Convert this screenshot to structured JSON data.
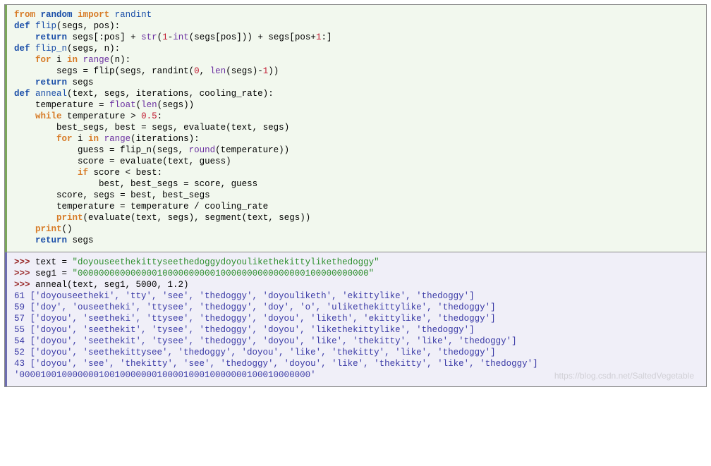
{
  "code": {
    "lines": [
      [
        [
          "kw-orange",
          "from"
        ],
        [
          "text",
          " "
        ],
        [
          "kw-blue",
          "random"
        ],
        [
          "text",
          " "
        ],
        [
          "kw-orange",
          "import"
        ],
        [
          "text",
          " "
        ],
        [
          "def",
          "randint"
        ]
      ],
      [
        [
          "text",
          ""
        ]
      ],
      [
        [
          "kw-blue",
          "def"
        ],
        [
          "text",
          " "
        ],
        [
          "def",
          "flip"
        ],
        [
          "op",
          "("
        ],
        [
          "text",
          "segs"
        ],
        [
          "op",
          ", "
        ],
        [
          "text",
          "pos"
        ],
        [
          "op",
          ")"
        ],
        [
          "op",
          ":"
        ]
      ],
      [
        [
          "text",
          "    "
        ],
        [
          "kw-blue",
          "return"
        ],
        [
          "text",
          " segs"
        ],
        [
          "op",
          "["
        ],
        [
          "op",
          ":"
        ],
        [
          "text",
          "pos"
        ],
        [
          "op",
          "]"
        ],
        [
          "text",
          " "
        ],
        [
          "op",
          "+"
        ],
        [
          "text",
          " "
        ],
        [
          "builtin",
          "str"
        ],
        [
          "op",
          "("
        ],
        [
          "num",
          "1"
        ],
        [
          "op",
          "-"
        ],
        [
          "builtin",
          "int"
        ],
        [
          "op",
          "("
        ],
        [
          "text",
          "segs"
        ],
        [
          "op",
          "["
        ],
        [
          "text",
          "pos"
        ],
        [
          "op",
          "]"
        ],
        [
          "op",
          ")"
        ],
        [
          "op",
          ")"
        ],
        [
          "text",
          " "
        ],
        [
          "op",
          "+"
        ],
        [
          "text",
          " segs"
        ],
        [
          "op",
          "["
        ],
        [
          "text",
          "pos"
        ],
        [
          "op",
          "+"
        ],
        [
          "num",
          "1"
        ],
        [
          "op",
          ":"
        ],
        [
          "op",
          "]"
        ]
      ],
      [
        [
          "text",
          ""
        ]
      ],
      [
        [
          "kw-blue",
          "def"
        ],
        [
          "text",
          " "
        ],
        [
          "def",
          "flip_n"
        ],
        [
          "op",
          "("
        ],
        [
          "text",
          "segs"
        ],
        [
          "op",
          ", "
        ],
        [
          "text",
          "n"
        ],
        [
          "op",
          ")"
        ],
        [
          "op",
          ":"
        ]
      ],
      [
        [
          "text",
          "    "
        ],
        [
          "kw-orange",
          "for"
        ],
        [
          "text",
          " i "
        ],
        [
          "kw-orange",
          "in"
        ],
        [
          "text",
          " "
        ],
        [
          "builtin",
          "range"
        ],
        [
          "op",
          "("
        ],
        [
          "text",
          "n"
        ],
        [
          "op",
          ")"
        ],
        [
          "op",
          ":"
        ]
      ],
      [
        [
          "text",
          "        segs "
        ],
        [
          "op",
          "="
        ],
        [
          "text",
          " flip"
        ],
        [
          "op",
          "("
        ],
        [
          "text",
          "segs"
        ],
        [
          "op",
          ", "
        ],
        [
          "text",
          "randint"
        ],
        [
          "op",
          "("
        ],
        [
          "num",
          "0"
        ],
        [
          "op",
          ", "
        ],
        [
          "builtin",
          "len"
        ],
        [
          "op",
          "("
        ],
        [
          "text",
          "segs"
        ],
        [
          "op",
          ")"
        ],
        [
          "op",
          "-"
        ],
        [
          "num",
          "1"
        ],
        [
          "op",
          ")"
        ],
        [
          "op",
          ")"
        ]
      ],
      [
        [
          "text",
          "    "
        ],
        [
          "kw-blue",
          "return"
        ],
        [
          "text",
          " segs"
        ]
      ],
      [
        [
          "text",
          ""
        ]
      ],
      [
        [
          "kw-blue",
          "def"
        ],
        [
          "text",
          " "
        ],
        [
          "def",
          "anneal"
        ],
        [
          "op",
          "("
        ],
        [
          "text",
          "text"
        ],
        [
          "op",
          ", "
        ],
        [
          "text",
          "segs"
        ],
        [
          "op",
          ", "
        ],
        [
          "text",
          "iterations"
        ],
        [
          "op",
          ", "
        ],
        [
          "text",
          "cooling_rate"
        ],
        [
          "op",
          ")"
        ],
        [
          "op",
          ":"
        ]
      ],
      [
        [
          "text",
          "    temperature "
        ],
        [
          "op",
          "="
        ],
        [
          "text",
          " "
        ],
        [
          "builtin",
          "float"
        ],
        [
          "op",
          "("
        ],
        [
          "builtin",
          "len"
        ],
        [
          "op",
          "("
        ],
        [
          "text",
          "segs"
        ],
        [
          "op",
          ")"
        ],
        [
          "op",
          ")"
        ]
      ],
      [
        [
          "text",
          "    "
        ],
        [
          "kw-orange",
          "while"
        ],
        [
          "text",
          " temperature "
        ],
        [
          "op",
          ">"
        ],
        [
          "text",
          " "
        ],
        [
          "num",
          "0.5"
        ],
        [
          "op",
          ":"
        ]
      ],
      [
        [
          "text",
          "        best_segs"
        ],
        [
          "op",
          ", "
        ],
        [
          "text",
          "best "
        ],
        [
          "op",
          "="
        ],
        [
          "text",
          " segs"
        ],
        [
          "op",
          ", "
        ],
        [
          "text",
          "evaluate"
        ],
        [
          "op",
          "("
        ],
        [
          "text",
          "text"
        ],
        [
          "op",
          ", "
        ],
        [
          "text",
          "segs"
        ],
        [
          "op",
          ")"
        ]
      ],
      [
        [
          "text",
          "        "
        ],
        [
          "kw-orange",
          "for"
        ],
        [
          "text",
          " i "
        ],
        [
          "kw-orange",
          "in"
        ],
        [
          "text",
          " "
        ],
        [
          "builtin",
          "range"
        ],
        [
          "op",
          "("
        ],
        [
          "text",
          "iterations"
        ],
        [
          "op",
          ")"
        ],
        [
          "op",
          ":"
        ]
      ],
      [
        [
          "text",
          "            guess "
        ],
        [
          "op",
          "="
        ],
        [
          "text",
          " flip_n"
        ],
        [
          "op",
          "("
        ],
        [
          "text",
          "segs"
        ],
        [
          "op",
          ", "
        ],
        [
          "builtin",
          "round"
        ],
        [
          "op",
          "("
        ],
        [
          "text",
          "temperature"
        ],
        [
          "op",
          ")"
        ],
        [
          "op",
          ")"
        ]
      ],
      [
        [
          "text",
          "            score "
        ],
        [
          "op",
          "="
        ],
        [
          "text",
          " evaluate"
        ],
        [
          "op",
          "("
        ],
        [
          "text",
          "text"
        ],
        [
          "op",
          ", "
        ],
        [
          "text",
          "guess"
        ],
        [
          "op",
          ")"
        ]
      ],
      [
        [
          "text",
          "            "
        ],
        [
          "kw-orange",
          "if"
        ],
        [
          "text",
          " score "
        ],
        [
          "op",
          "<"
        ],
        [
          "text",
          " best"
        ],
        [
          "op",
          ":"
        ]
      ],
      [
        [
          "text",
          "                best"
        ],
        [
          "op",
          ", "
        ],
        [
          "text",
          "best_segs "
        ],
        [
          "op",
          "="
        ],
        [
          "text",
          " score"
        ],
        [
          "op",
          ", "
        ],
        [
          "text",
          "guess"
        ]
      ],
      [
        [
          "text",
          "        score"
        ],
        [
          "op",
          ", "
        ],
        [
          "text",
          "segs "
        ],
        [
          "op",
          "="
        ],
        [
          "text",
          " best"
        ],
        [
          "op",
          ", "
        ],
        [
          "text",
          "best_segs"
        ]
      ],
      [
        [
          "text",
          "        temperature "
        ],
        [
          "op",
          "="
        ],
        [
          "text",
          " temperature "
        ],
        [
          "op",
          "/"
        ],
        [
          "text",
          " cooling_rate"
        ]
      ],
      [
        [
          "text",
          "        "
        ],
        [
          "kw-orange",
          "print"
        ],
        [
          "op",
          "("
        ],
        [
          "text",
          "evaluate"
        ],
        [
          "op",
          "("
        ],
        [
          "text",
          "text"
        ],
        [
          "op",
          ", "
        ],
        [
          "text",
          "segs"
        ],
        [
          "op",
          ")"
        ],
        [
          "op",
          ", "
        ],
        [
          "text",
          "segment"
        ],
        [
          "op",
          "("
        ],
        [
          "text",
          "text"
        ],
        [
          "op",
          ", "
        ],
        [
          "text",
          "segs"
        ],
        [
          "op",
          ")"
        ],
        [
          "op",
          ")"
        ]
      ],
      [
        [
          "text",
          "    "
        ],
        [
          "kw-orange",
          "print"
        ],
        [
          "op",
          "("
        ],
        [
          "op",
          ")"
        ]
      ],
      [
        [
          "text",
          "    "
        ],
        [
          "kw-blue",
          "return"
        ],
        [
          "text",
          " segs"
        ]
      ]
    ]
  },
  "repl": {
    "inputs": [
      {
        "var": "text",
        "assign": " = ",
        "string": "\"doyouseethekittyseethedoggydoyoulikethekittylikethedoggy\""
      },
      {
        "var": "seg1",
        "assign": " = ",
        "string": "\"0000000000000001000000000010000000000000000100000000000\""
      }
    ],
    "call": "anneal(text, seg1, 5000, 1.2)",
    "outputs": [
      "61 ['doyouseetheki', 'tty', 'see', 'thedoggy', 'doyouliketh', 'ekittylike', 'thedoggy']",
      "59 ['doy', 'ouseetheki', 'ttysee', 'thedoggy', 'doy', 'o', 'ulikethekittylike', 'thedoggy']",
      "57 ['doyou', 'seetheki', 'ttysee', 'thedoggy', 'doyou', 'liketh', 'ekittylike', 'thedoggy']",
      "55 ['doyou', 'seethekit', 'tysee', 'thedoggy', 'doyou', 'likethekittylike', 'thedoggy']",
      "54 ['doyou', 'seethekit', 'tysee', 'thedoggy', 'doyou', 'like', 'thekitty', 'like', 'thedoggy']",
      "52 ['doyou', 'seethekittysee', 'thedoggy', 'doyou', 'like', 'thekitty', 'like', 'thedoggy']",
      "43 ['doyou', 'see', 'thekitty', 'see', 'thedoggy', 'doyou', 'like', 'thekitty', 'like', 'thedoggy']",
      "'0000100100000001001000000010000100010000000100010000000'"
    ]
  },
  "watermark": "https://blog.csdn.net/SaltedVegetable"
}
